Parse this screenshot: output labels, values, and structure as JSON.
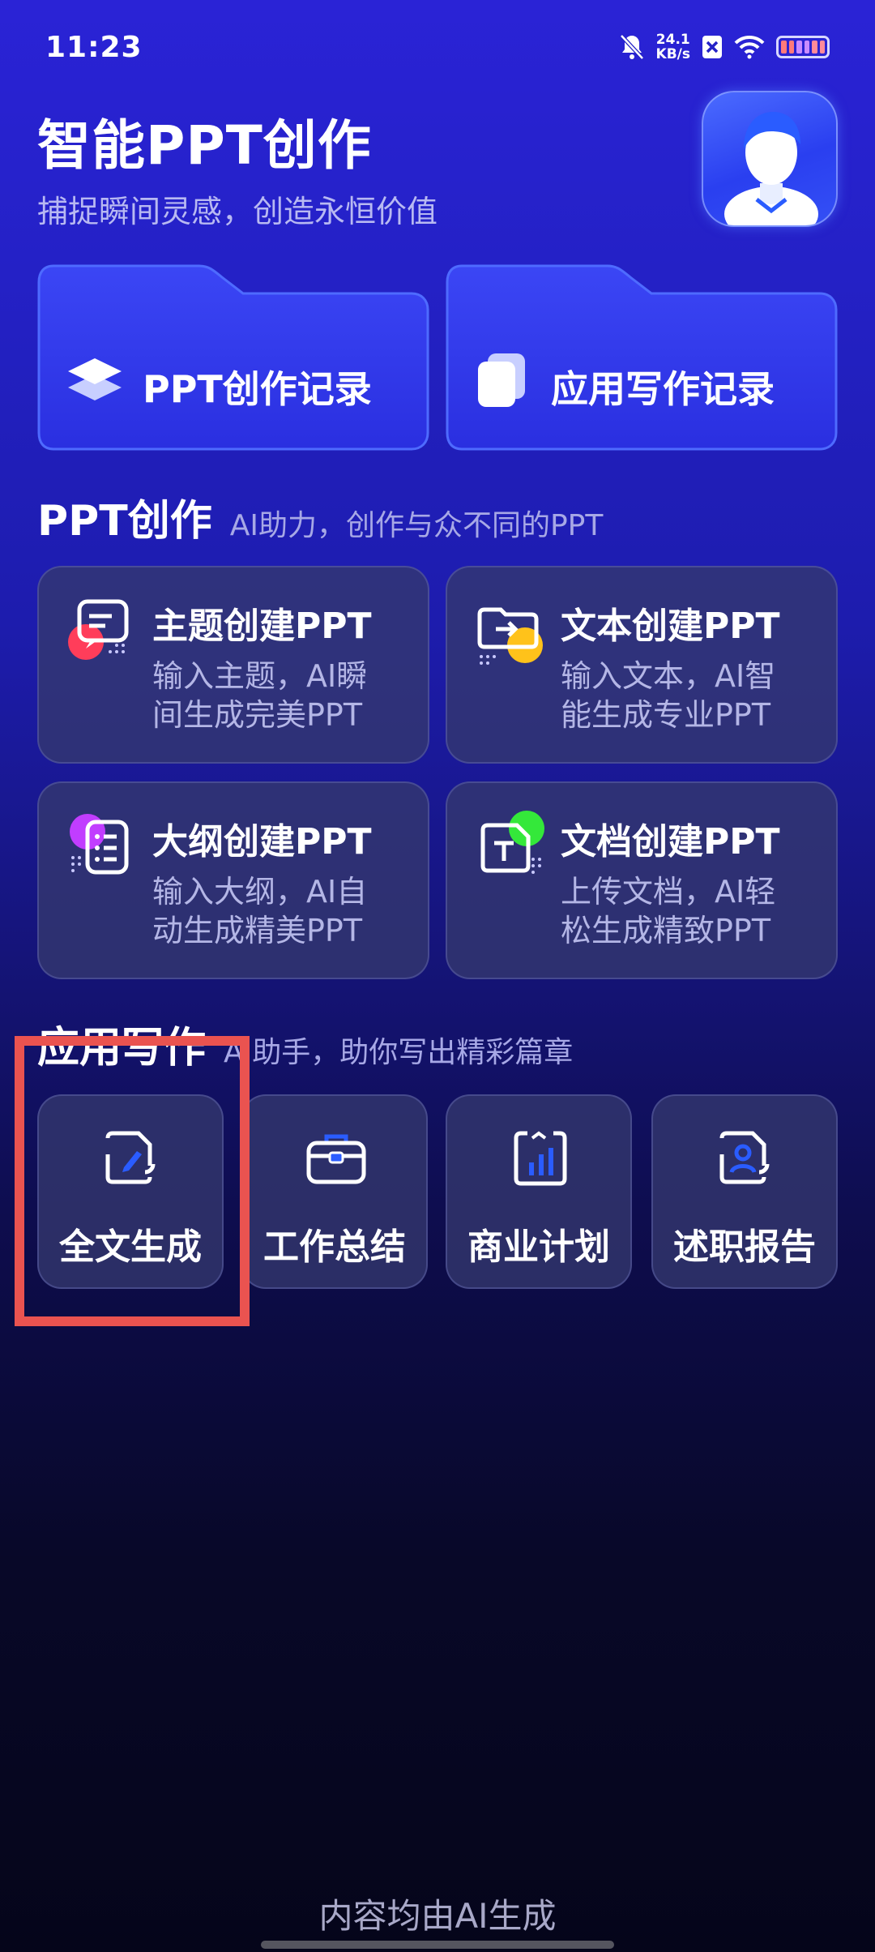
{
  "status_bar": {
    "time": "11:23",
    "speed_value": "24.1",
    "speed_unit": "KB/s",
    "icons": [
      "bell-off-icon",
      "x-box-icon",
      "wifi-icon",
      "battery-icon"
    ]
  },
  "header": {
    "title": "智能PPT创作",
    "subtitle": "捕捉瞬间灵感，创造永恒价值"
  },
  "records": {
    "ppt_record": "PPT创作记录",
    "writing_record": "应用写作记录"
  },
  "ppt_section": {
    "title": "PPT创作",
    "subtitle": "AI助力，创作与众不同的PPT",
    "cards": [
      {
        "title": "主题创建PPT",
        "desc_line1": "输入主题，AI瞬",
        "desc_line2": "间生成完美PPT",
        "accent": "#ff3d5a"
      },
      {
        "title": "文本创建PPT",
        "desc_line1": "输入文本，AI智",
        "desc_line2": "能生成专业PPT",
        "accent": "#ffc21a"
      },
      {
        "title": "大纲创建PPT",
        "desc_line1": "输入大纲，AI自",
        "desc_line2": "动生成精美PPT",
        "accent": "#c13dff"
      },
      {
        "title": "文档创建PPT",
        "desc_line1": "上传文档，AI轻",
        "desc_line2": "松生成精致PPT",
        "accent": "#34e83a"
      }
    ]
  },
  "writing_section": {
    "title": "应用写作",
    "subtitle": "AI助手，助你写出精彩篇章",
    "cards": [
      {
        "label": "全文生成",
        "icon": "document-pen-icon"
      },
      {
        "label": "工作总结",
        "icon": "briefcase-icon"
      },
      {
        "label": "商业计划",
        "icon": "bar-chart-icon"
      },
      {
        "label": "述职报告",
        "icon": "person-report-icon"
      }
    ]
  },
  "footer": {
    "text": "内容均由AI生成"
  },
  "colors": {
    "accent_blue": "#2a5cff",
    "highlight": "#ea5350"
  }
}
